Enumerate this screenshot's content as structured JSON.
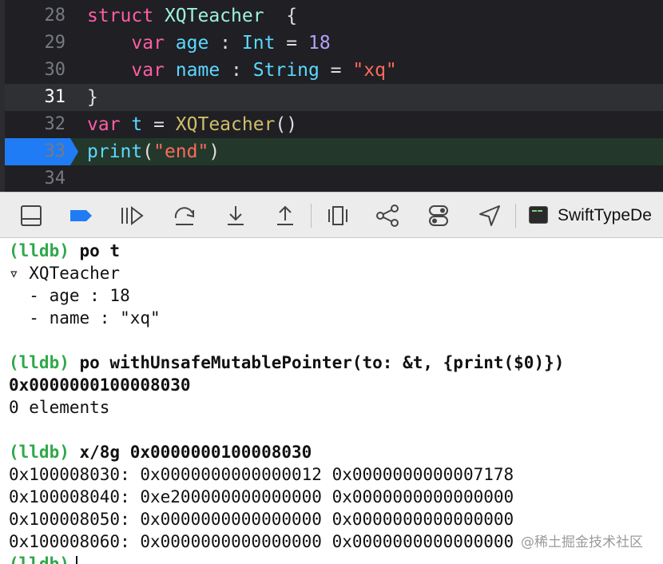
{
  "editor": {
    "lines": [
      {
        "num": "28",
        "tokens": [
          [
            "kw",
            "struct "
          ],
          [
            "cls",
            "XQTeacher"
          ],
          [
            "",
            "  {"
          ]
        ]
      },
      {
        "num": "29",
        "tokens": [
          [
            "",
            "    "
          ],
          [
            "kw",
            "var "
          ],
          [
            "ty",
            "age "
          ],
          [
            "",
            ": "
          ],
          [
            "ty",
            "Int "
          ],
          [
            "",
            "= "
          ],
          [
            "num",
            "18"
          ]
        ]
      },
      {
        "num": "30",
        "tokens": [
          [
            "",
            "    "
          ],
          [
            "kw",
            "var "
          ],
          [
            "ty",
            "name "
          ],
          [
            "",
            ": "
          ],
          [
            "ty",
            "String "
          ],
          [
            "",
            "= "
          ],
          [
            "str",
            "\"xq\""
          ]
        ]
      },
      {
        "num": "31",
        "tokens": [
          [
            "",
            "}"
          ]
        ]
      },
      {
        "num": "32",
        "tokens": [
          [
            "kw",
            "var "
          ],
          [
            "ty",
            "t "
          ],
          [
            "",
            "= "
          ],
          [
            "ty2",
            "XQTeacher"
          ],
          [
            "",
            "()"
          ]
        ]
      },
      {
        "num": "33",
        "tokens": [
          [
            "tyb",
            "print"
          ],
          [
            "",
            "("
          ],
          [
            "str",
            "\"end\""
          ],
          [
            "",
            ")"
          ]
        ]
      },
      {
        "num": "34",
        "tokens": []
      }
    ],
    "current_line": "31",
    "exec_line": "33"
  },
  "toolbar": {
    "icons": [
      "hide-debug-area-icon",
      "breakpoints-toggle-icon",
      "continue-icon",
      "step-over-icon",
      "step-into-icon",
      "step-out-icon",
      "debug-view-hierarchy-icon",
      "debug-memory-graph-icon",
      "environment-overrides-icon",
      "simulate-location-icon"
    ],
    "target_name": "SwiftTypeDe"
  },
  "console": {
    "lines": [
      {
        "prompt": "(lldb)",
        "text": " po t",
        "bold": true
      },
      {
        "text": "▿ XQTeacher"
      },
      {
        "text": "  - age : 18"
      },
      {
        "text": "  - name : \"xq\""
      },
      {
        "text": ""
      },
      {
        "prompt": "(lldb)",
        "text": " po withUnsafeMutablePointer(to: &t, {print($0)})",
        "bold": true
      },
      {
        "text": "0x0000000100008030",
        "bold": true
      },
      {
        "text": "0 elements"
      },
      {
        "text": ""
      },
      {
        "prompt": "(lldb)",
        "text": " x/8g 0x0000000100008030",
        "bold": true
      },
      {
        "text": "0x100008030: 0x0000000000000012 0x0000000000007178"
      },
      {
        "text": "0x100008040: 0xe200000000000000 0x0000000000000000"
      },
      {
        "text": "0x100008050: 0x0000000000000000 0x0000000000000000"
      },
      {
        "text": "0x100008060: 0x0000000000000000 0x0000000000000000"
      },
      {
        "prompt": "(lldb)",
        "text": "",
        "cursor": true
      }
    ]
  },
  "watermark": "@稀土掘金技术社区"
}
